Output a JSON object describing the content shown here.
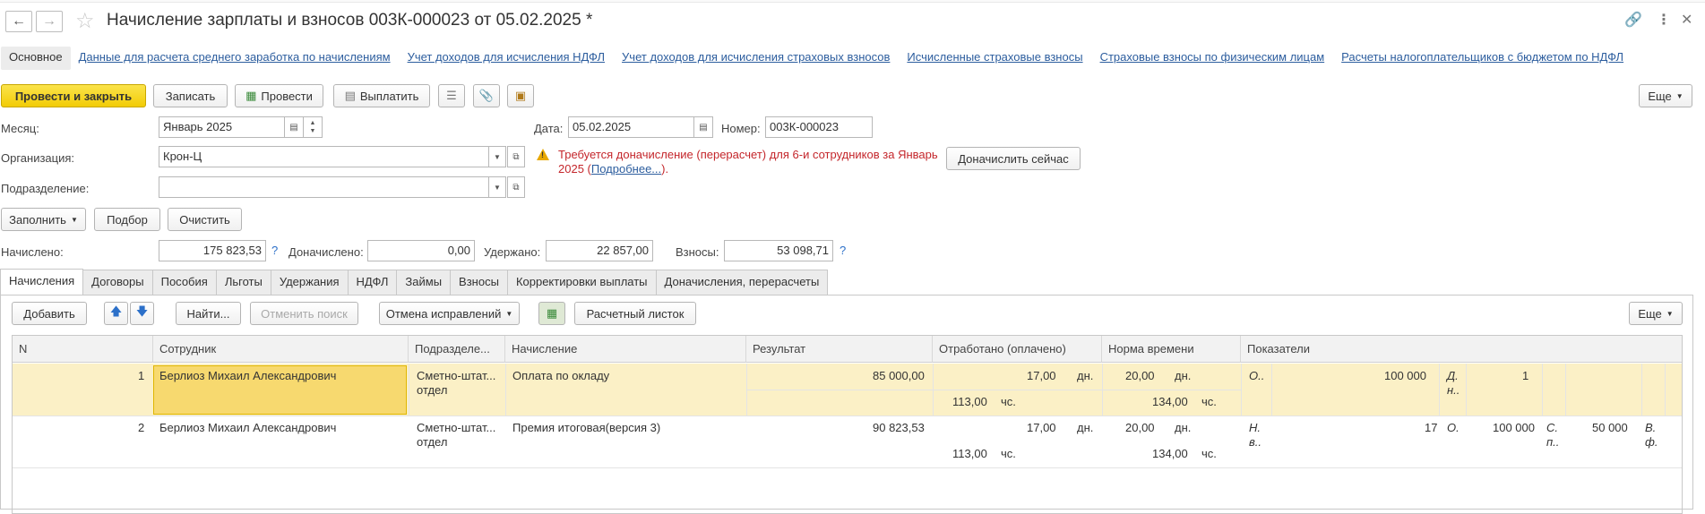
{
  "window": {
    "title": "Начисление зарплаты и взносов 003К-000023 от 05.02.2025 *"
  },
  "sections": [
    {
      "label": "Основное"
    },
    {
      "label": "Данные для расчета среднего заработка по начислениям"
    },
    {
      "label": "Учет доходов для исчисления НДФЛ"
    },
    {
      "label": "Учет доходов для исчисления страховых взносов"
    },
    {
      "label": "Исчисленные страховые взносы"
    },
    {
      "label": "Страховые взносы по физическим лицам"
    },
    {
      "label": "Расчеты налогоплательщиков с бюджетом по НДФЛ"
    }
  ],
  "toolbar": {
    "post_close": "Провести и закрыть",
    "save": "Записать",
    "post": "Провести",
    "pay": "Выплатить",
    "more": "Еще"
  },
  "form": {
    "month_label": "Месяц:",
    "month_value": "Январь 2025",
    "date_label": "Дата:",
    "date_value": "05.02.2025",
    "number_label": "Номер:",
    "number_value": "003К-000023",
    "org_label": "Организация:",
    "org_value": "Крон-Ц",
    "dept_label": "Подразделение:",
    "dept_value": "",
    "warning_text": "Требуется доначисление (перерасчет) для 6-и сотрудников за Январь 2025 (",
    "warning_link": "Подробнее...",
    "warning_tail": ").",
    "recalc_now": "Доначислить сейчас"
  },
  "fill_bar": {
    "fill": "Заполнить",
    "pick": "Подбор",
    "clear": "Очистить"
  },
  "totals": {
    "accrued_label": "Начислено:",
    "accrued_value": "175 823,53",
    "extra_label": "Доначислено:",
    "extra_value": "0,00",
    "withheld_label": "Удержано:",
    "withheld_value": "22 857,00",
    "contrib_label": "Взносы:",
    "contrib_value": "53 098,71",
    "help": "?"
  },
  "tabs": [
    {
      "label": "Начисления"
    },
    {
      "label": "Договоры"
    },
    {
      "label": "Пособия"
    },
    {
      "label": "Льготы"
    },
    {
      "label": "Удержания"
    },
    {
      "label": "НДФЛ"
    },
    {
      "label": "Займы"
    },
    {
      "label": "Взносы"
    },
    {
      "label": "Корректировки выплаты"
    },
    {
      "label": "Доначисления, перерасчеты"
    }
  ],
  "table_toolbar": {
    "add": "Добавить",
    "find": "Найти...",
    "cancel_search": "Отменить поиск",
    "cancel_corrections": "Отмена исправлений",
    "payslip": "Расчетный листок",
    "more": "Еще"
  },
  "table": {
    "columns": [
      "N",
      "Сотрудник",
      "Подразделе...",
      "Начисление",
      "Результат",
      "Отработано (оплачено)",
      "Норма времени",
      "Показатели"
    ],
    "rows": [
      {
        "n": "1",
        "employee": "Берлиоз Михаил Александрович",
        "dept_line1": "Сметно-штат...",
        "dept_line2": "отдел",
        "accrual": "Оплата по окладу",
        "result": "85 000,00",
        "worked_days": "17,00",
        "worked_days_unit": "дн.",
        "worked_hours": "113,00",
        "worked_hours_unit": "чс.",
        "norm_days": "20,00",
        "norm_days_unit": "дн.",
        "norm_hours": "134,00",
        "norm_hours_unit": "чс.",
        "ind1_name": "О..",
        "ind1_value": "100 000",
        "ind2_name_l1": "Д.",
        "ind2_name_l2": "н..",
        "ind2_value": "1"
      },
      {
        "n": "2",
        "employee": "Берлиоз Михаил Александрович",
        "dept_line1": "Сметно-штат...",
        "dept_line2": "отдел",
        "accrual": "Премия итоговая(версия 3)",
        "result": "90 823,53",
        "worked_days": "17,00",
        "worked_days_unit": "дн.",
        "worked_hours": "113,00",
        "worked_hours_unit": "чс.",
        "norm_days": "20,00",
        "norm_days_unit": "дн.",
        "norm_hours": "134,00",
        "norm_hours_unit": "чс.",
        "ind1_name_l1": "Н.",
        "ind1_name_l2": "в..",
        "ind1_value": "17",
        "ind2_name": "О.",
        "ind2_value": "100 000",
        "ind3_name_l1": "С.",
        "ind3_name_l2": "п..",
        "ind3_value": "50 000",
        "ind4_name_l1": "В.",
        "ind4_name_l2": "ф."
      }
    ]
  },
  "colors": {
    "primary_button": "#f2cc06",
    "link": "#2c5d9e",
    "warning": "#c4262b",
    "selected_row": "#fbf0c6"
  }
}
